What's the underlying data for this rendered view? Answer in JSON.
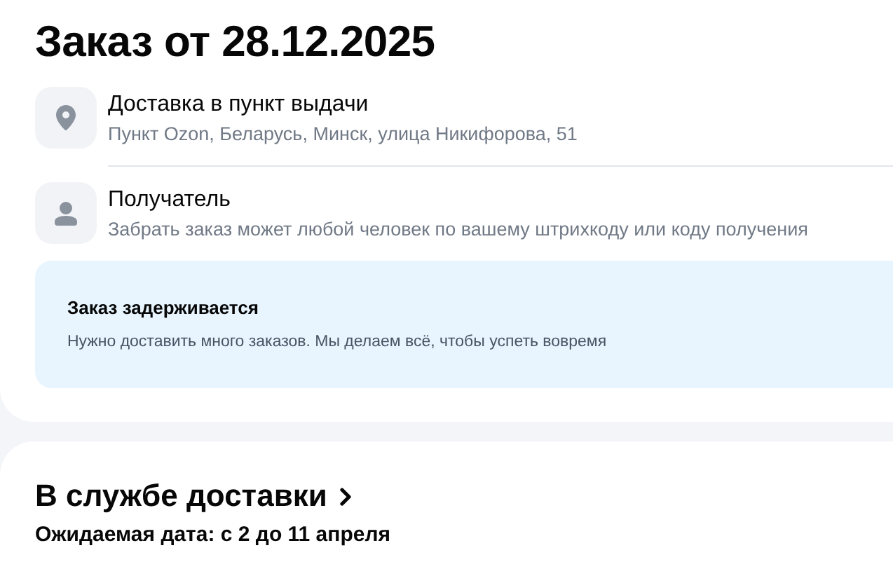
{
  "order": {
    "title": "Заказ от 28.12.2025",
    "details": [
      {
        "title": "Доставка в пункт выдачи",
        "subtitle": "Пункт Ozon, Беларусь, Минск, улица Никифорова, 51"
      },
      {
        "title": "Получатель",
        "subtitle": "Забрать заказ может любой человек по вашему штрихкоду или коду получения"
      }
    ],
    "notice": {
      "title": "Заказ задерживается",
      "text": "Нужно доставить много заказов. Мы делаем всё, чтобы успеть вовремя"
    }
  },
  "shipment": {
    "status": "В службе доставки",
    "expected": "Ожидаемая дата: с 2 до 11 апреля"
  }
}
